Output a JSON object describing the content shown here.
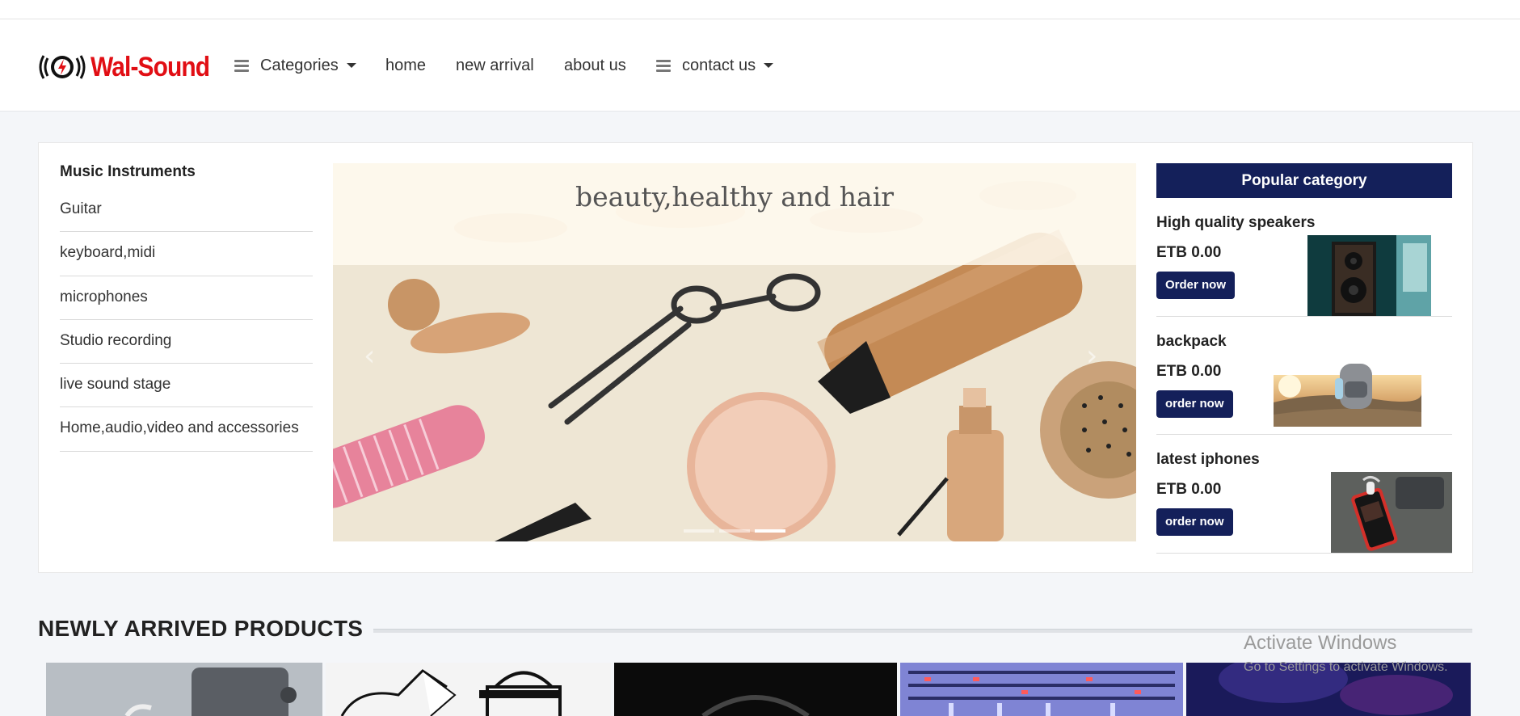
{
  "brand": {
    "name": "Wal-Sound",
    "color": "#e10e14"
  },
  "nav": {
    "categories": "Categories",
    "home": "home",
    "new_arrival": "new arrival",
    "about": "about us",
    "contact": "contact us"
  },
  "sidebar": {
    "title": "Music Instruments",
    "items": [
      {
        "label": "Guitar"
      },
      {
        "label": "keyboard,midi"
      },
      {
        "label": "microphones"
      },
      {
        "label": "Studio recording"
      },
      {
        "label": "live sound stage"
      },
      {
        "label": "Home,audio,video and accessories"
      }
    ]
  },
  "slider": {
    "caption": "beauty,healthy and hair",
    "prev_icon": "chevron-left-icon",
    "next_icon": "chevron-right-icon",
    "indicator_count": 3,
    "active_indicator": 3
  },
  "popular": {
    "title": "Popular category",
    "header_color": "#14205a",
    "items": [
      {
        "name": "High quality speakers",
        "price": "ETB 0.00",
        "button": "Order now",
        "image": "speaker-image"
      },
      {
        "name": "backpack",
        "price": "ETB 0.00",
        "button": "order now",
        "image": "backpack-image"
      },
      {
        "name": "latest iphones",
        "price": "ETB 0.00",
        "button": "order now",
        "image": "iphone-image"
      }
    ]
  },
  "new_products": {
    "title": "NEWLY ARRIVED PRODUCTS",
    "items": [
      "laptop-earbuds-image",
      "shopping-bags-sketch-image",
      "headphones-image",
      "mixing-console-image",
      "stage-lights-image"
    ]
  },
  "watermark": {
    "line1": "Activate Windows",
    "line2": "Go to Settings to activate Windows."
  }
}
